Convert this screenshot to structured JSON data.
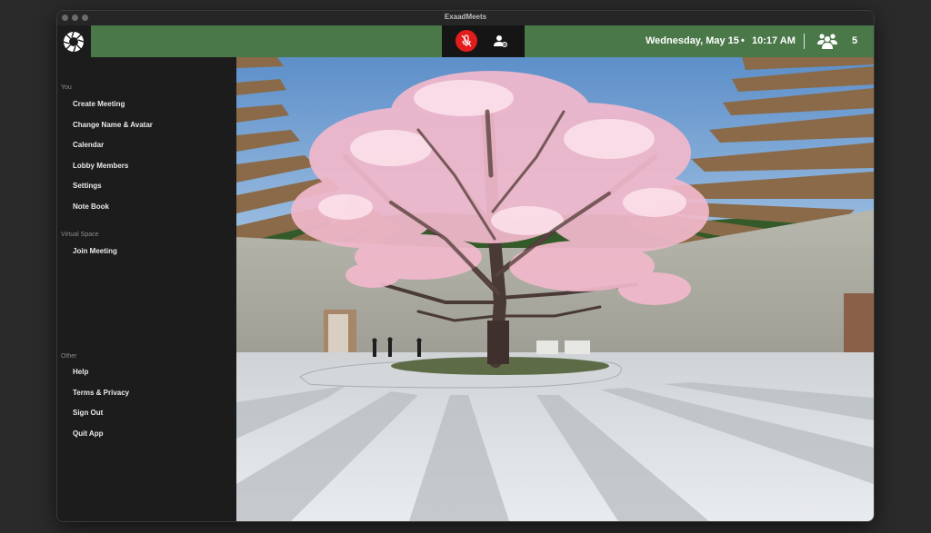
{
  "window": {
    "title": "ExaadMeets"
  },
  "sidebar": {
    "you_label": "You",
    "you_items": [
      {
        "label": "Create Meeting"
      },
      {
        "label": "Change Name & Avatar"
      },
      {
        "label": "Calendar"
      },
      {
        "label": "Lobby Members"
      },
      {
        "label": "Settings"
      },
      {
        "label": "Note Book"
      }
    ],
    "virtual_space_label": "Virtual Space",
    "virtual_space_items": [
      {
        "label": "Join Meeting"
      }
    ],
    "other_label": "Other",
    "other_items": [
      {
        "label": "Help"
      },
      {
        "label": "Terms & Privacy"
      },
      {
        "label": "Sign Out"
      },
      {
        "label": "Quit App"
      }
    ]
  },
  "topbar": {
    "date": "Wednesday, May 15",
    "separator": "•",
    "time": "10:17 AM",
    "member_count": "5",
    "members_icon": "people-group-icon",
    "mic_icon": "mic-muted-icon",
    "user_icon": "user-settings-icon"
  },
  "colors": {
    "topbar_green": "#4a7848",
    "sidebar_bg": "#1c1c1c",
    "mic_muted_red": "#e31c1c",
    "call_controls_bg": "#151515"
  },
  "scene": {
    "description_icon": "virtual-space-view"
  }
}
